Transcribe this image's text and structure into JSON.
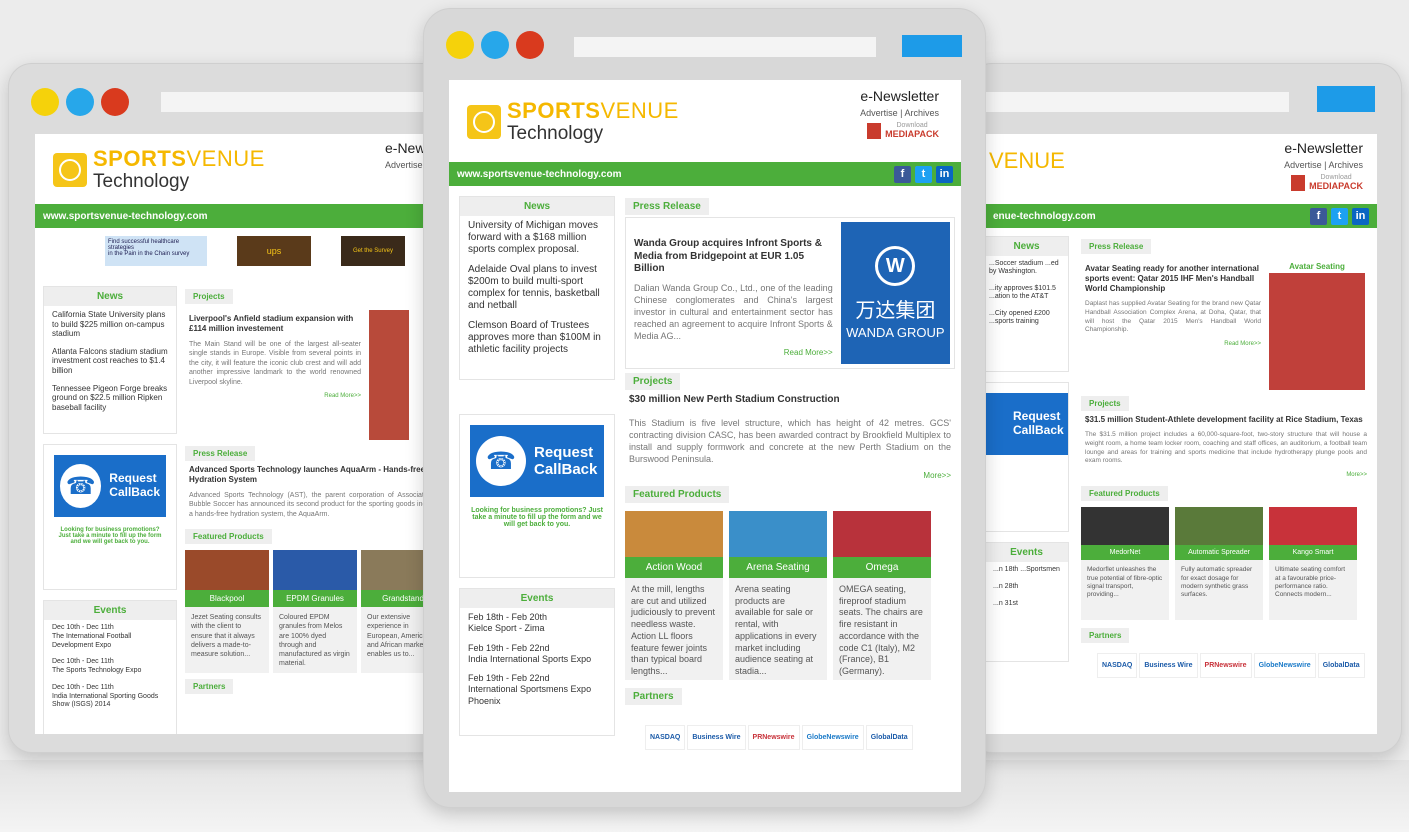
{
  "brand": {
    "logo_sports": "SPORTS",
    "logo_venue": "VENUE",
    "logo_technology": "Technology",
    "enewsletter": "e-Newsletter",
    "enewsletter_cut": "e-News",
    "advertise_archives": "Advertise | Archives",
    "advertise_cut": "Advertise",
    "download": "Download",
    "mediapack": "MEDIAPACK",
    "site_url": "www.sportsvenue-technology.com",
    "site_url_cut": "enue-technology.com",
    "venue_cut": "VENUE"
  },
  "colors": {
    "green": "#4cae3b",
    "yellow": "#f5b800",
    "blue": "#1a6ec9"
  },
  "social": {
    "facebook": "f",
    "twitter": "t",
    "linkedin": "in"
  },
  "sections": {
    "news": "News",
    "press_release": "Press Release",
    "projects": "Projects",
    "featured_products": "Featured Products",
    "events": "Events",
    "partners": "Partners"
  },
  "callback": {
    "line1": "Request",
    "line2": "CallBack",
    "promo": "Looking for business promotions? Just take a minute to fill up the form and we will get back to you.",
    "phone_icon": "☎"
  },
  "center": {
    "news": [
      "University of Michigan moves forward with a $168 million sports complex proposal.",
      "Adelaide Oval plans to invest $200m to build multi-sport complex for tennis, basketball and netball",
      "Clemson Board of Trustees approves more than $100M in athletic facility projects"
    ],
    "press": {
      "title": "Wanda Group acquires Infront Sports & Media from Bridgepoint at EUR 1.05 Billion",
      "body": "Dalian Wanda Group Co., Ltd., one of the leading Chinese conglomerates and China's largest investor in cultural and entertainment sector has reached an agreement to acquire Infront Sports & Media AG...",
      "read_more": "Read More>>",
      "wanda_cn": "万达集团",
      "wanda_en": "WANDA GROUP"
    },
    "project": {
      "title": "$30 million New Perth Stadium Construction",
      "body": "This Stadium is five level structure, which has height of 42 metres. GCS' contracting division CASC, has been awarded contract by Brookfield Multiplex to install and supply formwork and concrete at the new Perth Stadium on the Burswood Peninsula.",
      "more": "More>>"
    },
    "products": [
      {
        "label": "Action Wood",
        "desc": "At the mill, lengths are cut and utilized judiciously to prevent needless waste. Action LL floors feature fewer joints than typical board lengths...",
        "color": "#c98a3c"
      },
      {
        "label": "Arena Seating",
        "desc": "Arena seating products are available for sale or rental, with applications in every market including audience seating at stadia...",
        "color": "#3a8fc9"
      },
      {
        "label": "Omega",
        "desc": "OMEGA seating, fireproof stadium seats. The chairs are fire resistant in accordance with the code C1 (Italy), M2 (France), B1 (Germany).",
        "color": "#b8323b"
      }
    ],
    "events": [
      {
        "date": "Feb 18th - Feb 20th",
        "name": "Kielce Sport - Zima"
      },
      {
        "date": "Feb 19th - Feb 22nd",
        "name": "India International Sports Expo"
      },
      {
        "date": "Feb 19th - Feb 22nd",
        "name": "International Sportsmens Expo Phoenix"
      }
    ],
    "partners": [
      "NASDAQ",
      "Business Wire",
      "PRNewswire",
      "GlobeNewswire",
      "GlobalData"
    ]
  },
  "left": {
    "banner": {
      "line1": "Find successful healthcare strategies",
      "line2": "in the Pain in the Chain survey",
      "ups": "ups",
      "survey": "Get the Survey"
    },
    "news": [
      "California State University plans to build $225 million on-campus stadium",
      "Atlanta Falcons stadium stadium investment cost reaches to $1.4 billion",
      "Tennessee Pigeon Forge breaks ground on $22.5 million Ripken baseball facility"
    ],
    "project": {
      "title": "Liverpool's Anfield stadium expansion with £114 million investement",
      "body": "The Main Stand will be one of the largest all-seater single stands in Europe. Visible from several points in the city, it will feature the iconic club crest and will add another impressive landmark to the world renowned Liverpool skyline.",
      "read_more": "Read More>>"
    },
    "press": {
      "title": "Advanced Sports Technology launches AquaArm - Hands-free Hydration System",
      "body": "Advanced Sports Technology (AST), the parent corporation of Association of Bubble Soccer has announced its second product for the sporting goods industry, a hands-free hydration system, the AquaArm."
    },
    "products": [
      {
        "label": "Blackpool",
        "desc": "Jezet Seating consults with the client to ensure that it always delivers a made-to-measure solution...",
        "color": "#9a4a2a"
      },
      {
        "label": "EPDM Granules",
        "desc": "Coloured EPDM granules from Melos are 100% dyed through and manufactured as virgin material.",
        "color": "#2a5aa8"
      },
      {
        "label": "Grandstand",
        "desc": "Our extensive experience in European, American and African markets enables us to...",
        "color": "#8a7a5a"
      }
    ],
    "events": [
      {
        "date": "Dec 10th - Dec 11th",
        "name": "The International Football Development Expo"
      },
      {
        "date": "Dec 10th - Dec 11th",
        "name": "The Sports Technology Expo"
      },
      {
        "date": "Dec 10th - Dec 11th",
        "name": "India International Sporting Goods Show (ISGS) 2014"
      }
    ]
  },
  "right": {
    "news": [
      "...Soccer stadium ...ed by Washington.",
      "...ity approves $101.5 ...ation to the AT&T",
      "...City opened £200 ...sports training"
    ],
    "press": {
      "title": "Avatar Seating ready for another international sports event: Qatar 2015 IHF Men's Handball World Championship",
      "body": "Daplast has supplied Avatar Seating for the brand new Qatar Handball Association Complex Arena, at Doha, Qatar, that will host the Qatar 2015 Men's Handball World Championship.",
      "read_more": "Read More>>",
      "avatar_label": "Avatar Seating"
    },
    "project": {
      "title": "$31.5 million Student-Athlete development facility at Rice Stadium, Texas",
      "body": "The $31.5 million project includes a 60,000-square-foot, two-story structure that will house a weight room, a home team locker room, coaching and staff offices, an auditorium, a football team lounge and areas for training and sports medicine that include hydrotherapy plunge pools and exam rooms.",
      "more": "More>>"
    },
    "products": [
      {
        "label": "MedorNet",
        "desc": "Medorflet unleashes the true potential of fibre-optic signal transport, providing...",
        "color": "#333333"
      },
      {
        "label": "Automatic Spreader",
        "desc": "Fully automatic spreader for exact dosage for modern synthetic grass surfaces.",
        "color": "#5a7a3a"
      },
      {
        "label": "Kango Smart",
        "desc": "Ultimate seating comfort at a favourable price-performance ratio. Connects modern...",
        "color": "#c8323a"
      }
    ],
    "events": [
      "...n 18th ...Sportsmen",
      "...n 28th",
      "...n 31st"
    ],
    "partners": [
      "NASDAQ",
      "Business Wire",
      "PRNewswire",
      "GlobeNewswire",
      "GlobalData"
    ]
  }
}
